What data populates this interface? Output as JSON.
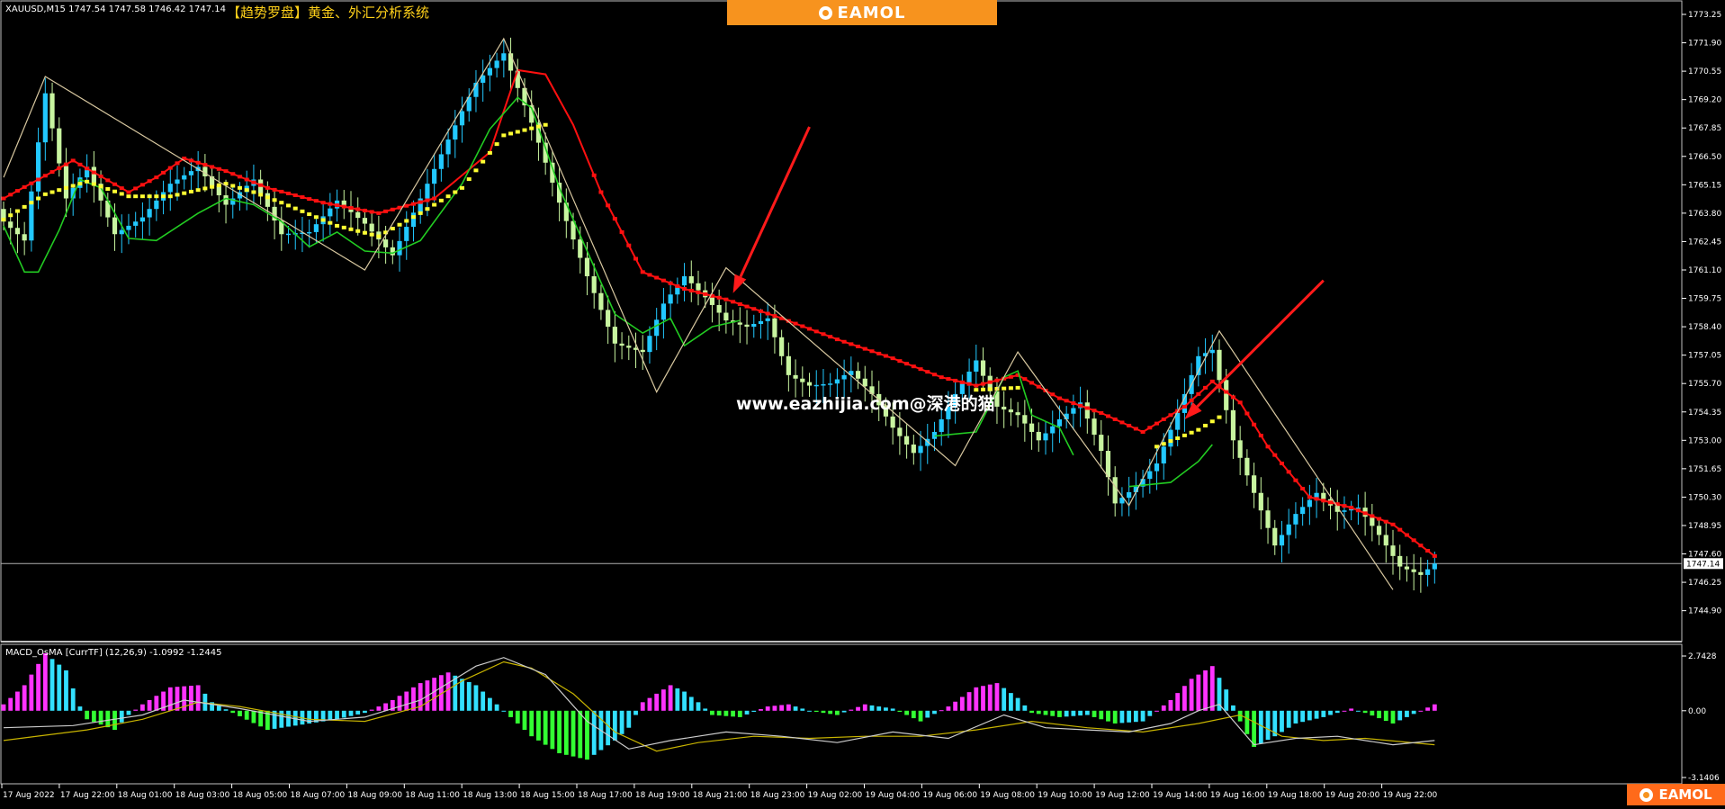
{
  "header": {
    "symbol_info": "XAUUSD,M15  1747.54 1747.58 1746.42 1747.14",
    "system_name": "【趋势罗盘】黄金、外汇分析系统",
    "brand": "EAMOL",
    "watermark": "www.eazhijia.com@深港的猫",
    "corner_brand": "EAMOL"
  },
  "colors": {
    "background": "#000000",
    "bull_candle": "#22c8ff",
    "bear_candle": "#c8f5a0",
    "red_line": "#ff1010",
    "green_line": "#22cc22",
    "yellow_line": "#ffff33",
    "zigzag": "#d8c8a0",
    "macd_positive_up": "#ff33ff",
    "macd_positive_down": "#33e0ff",
    "macd_negative_down": "#33ff33",
    "macd_negative_up": "#33e0ff",
    "signal_line": "#c8b400",
    "macd_line": "#cccccc",
    "arrow": "#ff1a1a",
    "axis": "#ffffff"
  },
  "chart_data": [
    {
      "type": "candlestick",
      "symbol": "XAUUSD",
      "timeframe": "M15",
      "quote": {
        "open": 1747.54,
        "high": 1747.58,
        "low": 1746.42,
        "close": 1747.14
      },
      "current_price_label": "1747.14",
      "ylim": [
        1744.97,
        1773.25
      ],
      "y_ticks": [
        "1773.25",
        "1771.90",
        "1770.55",
        "1769.20",
        "1767.85",
        "1766.50",
        "1765.15",
        "1763.80",
        "1762.45",
        "1761.10",
        "1759.75",
        "1758.40",
        "1757.05",
        "1755.70",
        "1754.35",
        "1753.00",
        "1751.65",
        "1750.30",
        "1748.95",
        "1747.60",
        "1746.25",
        "1744.90"
      ],
      "x_ticks": [
        "17 Aug 2022",
        "17 Aug 22:00",
        "18 Aug 01:00",
        "18 Aug 03:00",
        "18 Aug 05:00",
        "18 Aug 07:00",
        "18 Aug 09:00",
        "18 Aug 11:00",
        "18 Aug 13:00",
        "18 Aug 15:00",
        "18 Aug 17:00",
        "18 Aug 19:00",
        "18 Aug 21:00",
        "18 Aug 23:00",
        "19 Aug 02:00",
        "19 Aug 04:00",
        "19 Aug 06:00",
        "19 Aug 08:00",
        "19 Aug 10:00",
        "19 Aug 12:00",
        "19 Aug 14:00",
        "19 Aug 16:00",
        "19 Aug 18:00",
        "19 Aug 20:00",
        "19 Aug 22:00"
      ],
      "close_anchors": [
        [
          0,
          1763.4
        ],
        [
          3,
          1762.5
        ],
        [
          6,
          1769.5
        ],
        [
          9,
          1764.5
        ],
        [
          12,
          1766.0
        ],
        [
          16,
          1762.8
        ],
        [
          20,
          1763.6
        ],
        [
          24,
          1765.2
        ],
        [
          28,
          1766.0
        ],
        [
          32,
          1764.2
        ],
        [
          36,
          1765.4
        ],
        [
          40,
          1762.8
        ],
        [
          44,
          1762.9
        ],
        [
          48,
          1764.4
        ],
        [
          52,
          1763.3
        ],
        [
          56,
          1761.8
        ],
        [
          60,
          1764.5
        ],
        [
          64,
          1767.3
        ],
        [
          68,
          1770.0
        ],
        [
          72,
          1771.4
        ],
        [
          76,
          1768.1
        ],
        [
          80,
          1764.3
        ],
        [
          84,
          1760.8
        ],
        [
          88,
          1757.6
        ],
        [
          92,
          1757.2
        ],
        [
          95,
          1759.5
        ],
        [
          98,
          1760.8
        ],
        [
          101,
          1759.8
        ],
        [
          104,
          1758.7
        ],
        [
          107,
          1758.4
        ],
        [
          110,
          1758.8
        ],
        [
          113,
          1756.1
        ],
        [
          116,
          1755.6
        ],
        [
          119,
          1755.7
        ],
        [
          122,
          1756.3
        ],
        [
          125,
          1755.2
        ],
        [
          128,
          1753.6
        ],
        [
          131,
          1752.4
        ],
        [
          134,
          1753.4
        ],
        [
          137,
          1755.2
        ],
        [
          140,
          1756.8
        ],
        [
          143,
          1754.6
        ],
        [
          146,
          1754.2
        ],
        [
          149,
          1753.0
        ],
        [
          152,
          1754.0
        ],
        [
          155,
          1754.8
        ],
        [
          158,
          1752.5
        ],
        [
          160,
          1750.0
        ],
        [
          163,
          1750.8
        ],
        [
          166,
          1751.9
        ],
        [
          169,
          1754.3
        ],
        [
          172,
          1757.0
        ],
        [
          174,
          1757.3
        ],
        [
          177,
          1753.0
        ],
        [
          180,
          1750.5
        ],
        [
          183,
          1748.0
        ],
        [
          186,
          1749.5
        ],
        [
          189,
          1750.5
        ],
        [
          192,
          1749.6
        ],
        [
          195,
          1749.8
        ],
        [
          198,
          1748.5
        ],
        [
          201,
          1747.0
        ],
        [
          204,
          1746.6
        ],
        [
          206,
          1747.14
        ]
      ],
      "zigzag": [
        [
          0,
          1765.5
        ],
        [
          6,
          1770.3
        ],
        [
          52,
          1761.1
        ],
        [
          72,
          1772.1
        ],
        [
          94,
          1755.3
        ],
        [
          104,
          1761.2
        ],
        [
          137,
          1751.8
        ],
        [
          146,
          1757.2
        ],
        [
          162,
          1749.9
        ],
        [
          175,
          1758.2
        ],
        [
          200,
          1745.9
        ]
      ],
      "red_line": [
        [
          0,
          1764.5
        ],
        [
          10,
          1766.3
        ],
        [
          18,
          1764.8
        ],
        [
          22,
          1765.5
        ],
        [
          26,
          1766.4
        ],
        [
          32,
          1765.8
        ],
        [
          38,
          1765.0
        ],
        [
          46,
          1764.3
        ],
        [
          54,
          1763.8
        ],
        [
          62,
          1764.5
        ],
        [
          70,
          1766.7
        ],
        [
          74,
          1770.6
        ],
        [
          78,
          1770.4
        ],
        [
          82,
          1768.0
        ],
        [
          86,
          1764.8
        ],
        [
          92,
          1761.0
        ],
        [
          98,
          1760.2
        ],
        [
          104,
          1759.7
        ],
        [
          112,
          1758.8
        ],
        [
          120,
          1757.8
        ],
        [
          128,
          1756.9
        ],
        [
          135,
          1756.0
        ],
        [
          140,
          1755.6
        ],
        [
          146,
          1756.1
        ],
        [
          152,
          1755.0
        ],
        [
          158,
          1754.3
        ],
        [
          164,
          1753.4
        ],
        [
          170,
          1754.6
        ],
        [
          174,
          1755.8
        ],
        [
          178,
          1754.8
        ],
        [
          182,
          1752.7
        ],
        [
          188,
          1750.3
        ],
        [
          194,
          1749.8
        ],
        [
          200,
          1749.0
        ],
        [
          206,
          1747.5
        ]
      ],
      "green_line": [
        [
          0,
          1763.2
        ],
        [
          3,
          1761.0
        ],
        [
          5,
          1761.0
        ],
        [
          8,
          1763.0
        ],
        [
          11,
          1765.4
        ],
        [
          14,
          1765.0
        ],
        [
          18,
          1762.6
        ],
        [
          22,
          1762.5
        ],
        [
          28,
          1763.8
        ],
        [
          32,
          1764.5
        ],
        [
          36,
          1764.2
        ],
        [
          40,
          1763.4
        ],
        [
          44,
          1762.2
        ],
        [
          48,
          1762.9
        ],
        [
          52,
          1762.0
        ],
        [
          56,
          1761.9
        ],
        [
          60,
          1762.5
        ],
        [
          66,
          1765.2
        ],
        [
          70,
          1767.8
        ],
        [
          74,
          1769.3
        ],
        [
          76,
          1768.8
        ],
        [
          80,
          1765.0
        ],
        [
          84,
          1762.0
        ],
        [
          88,
          1759.0
        ],
        [
          92,
          1758.1
        ],
        [
          96,
          1758.8
        ],
        [
          98,
          1757.5
        ],
        [
          102,
          1758.4
        ],
        [
          106,
          1758.7
        ]
      ],
      "green_line_b": [
        [
          134,
          1753.2
        ],
        [
          140,
          1753.4
        ],
        [
          144,
          1756.0
        ],
        [
          146,
          1756.3
        ],
        [
          148,
          1754.2
        ],
        [
          152,
          1753.6
        ],
        [
          154,
          1752.3
        ]
      ],
      "green_line_c": [
        [
          162,
          1750.8
        ],
        [
          168,
          1751.0
        ],
        [
          172,
          1752.0
        ],
        [
          174,
          1752.8
        ]
      ],
      "yellow_line": [
        [
          0,
          1763.5
        ],
        [
          6,
          1764.7
        ],
        [
          12,
          1765.3
        ],
        [
          18,
          1764.6
        ],
        [
          24,
          1764.6
        ],
        [
          32,
          1765.2
        ],
        [
          36,
          1764.8
        ],
        [
          40,
          1764.3
        ],
        [
          48,
          1763.2
        ],
        [
          54,
          1762.7
        ],
        [
          60,
          1763.8
        ],
        [
          66,
          1765.0
        ],
        [
          72,
          1767.5
        ],
        [
          78,
          1768.0
        ]
      ],
      "yellow_line_b": [
        [
          140,
          1755.4
        ],
        [
          146,
          1755.5
        ]
      ],
      "yellow_line_c": [
        [
          166,
          1752.7
        ],
        [
          172,
          1753.5
        ],
        [
          175,
          1754.1
        ]
      ],
      "annotations": [
        {
          "type": "arrow",
          "from": [
            116,
            1767.9
          ],
          "to": [
            105,
            1760.0
          ]
        },
        {
          "type": "arrow",
          "from": [
            190,
            1760.6
          ],
          "to": [
            170,
            1754.0
          ]
        }
      ]
    },
    {
      "type": "histogram",
      "title": "MACD_OsMA [CurrTF] (12,26,9) -1.0992 -1.2445",
      "ylim": [
        -3.1406,
        2.7428
      ],
      "y_ticks": [
        "2.7428",
        "0.00",
        "-3.1406"
      ],
      "hist_anchors": [
        [
          0,
          0.3
        ],
        [
          3,
          1.2
        ],
        [
          6,
          2.7
        ],
        [
          9,
          1.9
        ],
        [
          11,
          0.2
        ],
        [
          12,
          -0.4
        ],
        [
          16,
          -0.9
        ],
        [
          18,
          -0.2
        ],
        [
          20,
          0.3
        ],
        [
          24,
          1.1
        ],
        [
          28,
          1.2
        ],
        [
          30,
          0.4
        ],
        [
          33,
          -0.1
        ],
        [
          38,
          -0.9
        ],
        [
          44,
          -0.6
        ],
        [
          48,
          -0.4
        ],
        [
          52,
          -0.1
        ],
        [
          56,
          0.5
        ],
        [
          60,
          1.3
        ],
        [
          64,
          1.8
        ],
        [
          68,
          1.2
        ],
        [
          70,
          0.6
        ],
        [
          72,
          0.0
        ],
        [
          76,
          -1.2
        ],
        [
          80,
          -2.0
        ],
        [
          84,
          -2.3
        ],
        [
          88,
          -1.4
        ],
        [
          90,
          -0.8
        ],
        [
          92,
          0.4
        ],
        [
          96,
          1.2
        ],
        [
          98,
          0.9
        ],
        [
          100,
          0.4
        ],
        [
          102,
          -0.2
        ],
        [
          106,
          -0.3
        ],
        [
          110,
          0.2
        ],
        [
          113,
          0.3
        ],
        [
          116,
          0.0
        ],
        [
          120,
          -0.2
        ],
        [
          124,
          0.3
        ],
        [
          128,
          0.1
        ],
        [
          132,
          -0.5
        ],
        [
          136,
          0.2
        ],
        [
          140,
          1.1
        ],
        [
          143,
          1.3
        ],
        [
          146,
          0.6
        ],
        [
          148,
          -0.1
        ],
        [
          152,
          -0.3
        ],
        [
          156,
          -0.2
        ],
        [
          160,
          -0.6
        ],
        [
          164,
          -0.5
        ],
        [
          168,
          0.5
        ],
        [
          171,
          1.5
        ],
        [
          174,
          2.1
        ],
        [
          176,
          1.0
        ],
        [
          178,
          -0.5
        ],
        [
          180,
          -1.7
        ],
        [
          183,
          -1.2
        ],
        [
          186,
          -0.6
        ],
        [
          190,
          -0.3
        ],
        [
          194,
          0.1
        ],
        [
          196,
          -0.1
        ],
        [
          200,
          -0.6
        ],
        [
          204,
          0.0
        ],
        [
          206,
          0.3
        ]
      ],
      "line1_anchors": [
        [
          0,
          -0.8
        ],
        [
          10,
          -0.7
        ],
        [
          20,
          -0.2
        ],
        [
          26,
          0.5
        ],
        [
          34,
          0.1
        ],
        [
          44,
          -0.5
        ],
        [
          52,
          -0.3
        ],
        [
          60,
          0.5
        ],
        [
          68,
          2.1
        ],
        [
          72,
          2.5
        ],
        [
          78,
          1.7
        ],
        [
          84,
          -0.5
        ],
        [
          90,
          -1.8
        ],
        [
          96,
          -1.4
        ],
        [
          104,
          -1.0
        ],
        [
          112,
          -1.2
        ],
        [
          120,
          -1.5
        ],
        [
          128,
          -1.0
        ],
        [
          136,
          -1.3
        ],
        [
          144,
          -0.2
        ],
        [
          150,
          -0.8
        ],
        [
          156,
          -0.9
        ],
        [
          162,
          -1.0
        ],
        [
          168,
          -0.6
        ],
        [
          172,
          0.0
        ],
        [
          175,
          0.3
        ],
        [
          180,
          -1.6
        ],
        [
          186,
          -1.3
        ],
        [
          192,
          -1.2
        ],
        [
          200,
          -1.6
        ],
        [
          206,
          -1.4
        ]
      ],
      "line2_anchors": [
        [
          0,
          -1.4
        ],
        [
          12,
          -0.9
        ],
        [
          20,
          -0.4
        ],
        [
          28,
          0.4
        ],
        [
          34,
          0.2
        ],
        [
          44,
          -0.4
        ],
        [
          52,
          -0.5
        ],
        [
          60,
          0.2
        ],
        [
          66,
          1.4
        ],
        [
          72,
          2.3
        ],
        [
          76,
          2.0
        ],
        [
          82,
          0.8
        ],
        [
          88,
          -1.0
        ],
        [
          94,
          -1.9
        ],
        [
          100,
          -1.5
        ],
        [
          108,
          -1.2
        ],
        [
          116,
          -1.3
        ],
        [
          124,
          -1.2
        ],
        [
          132,
          -1.2
        ],
        [
          140,
          -0.9
        ],
        [
          148,
          -0.5
        ],
        [
          156,
          -0.8
        ],
        [
          164,
          -1.0
        ],
        [
          172,
          -0.6
        ],
        [
          178,
          -0.2
        ],
        [
          184,
          -1.2
        ],
        [
          190,
          -1.4
        ],
        [
          196,
          -1.3
        ],
        [
          206,
          -1.6
        ]
      ]
    }
  ]
}
